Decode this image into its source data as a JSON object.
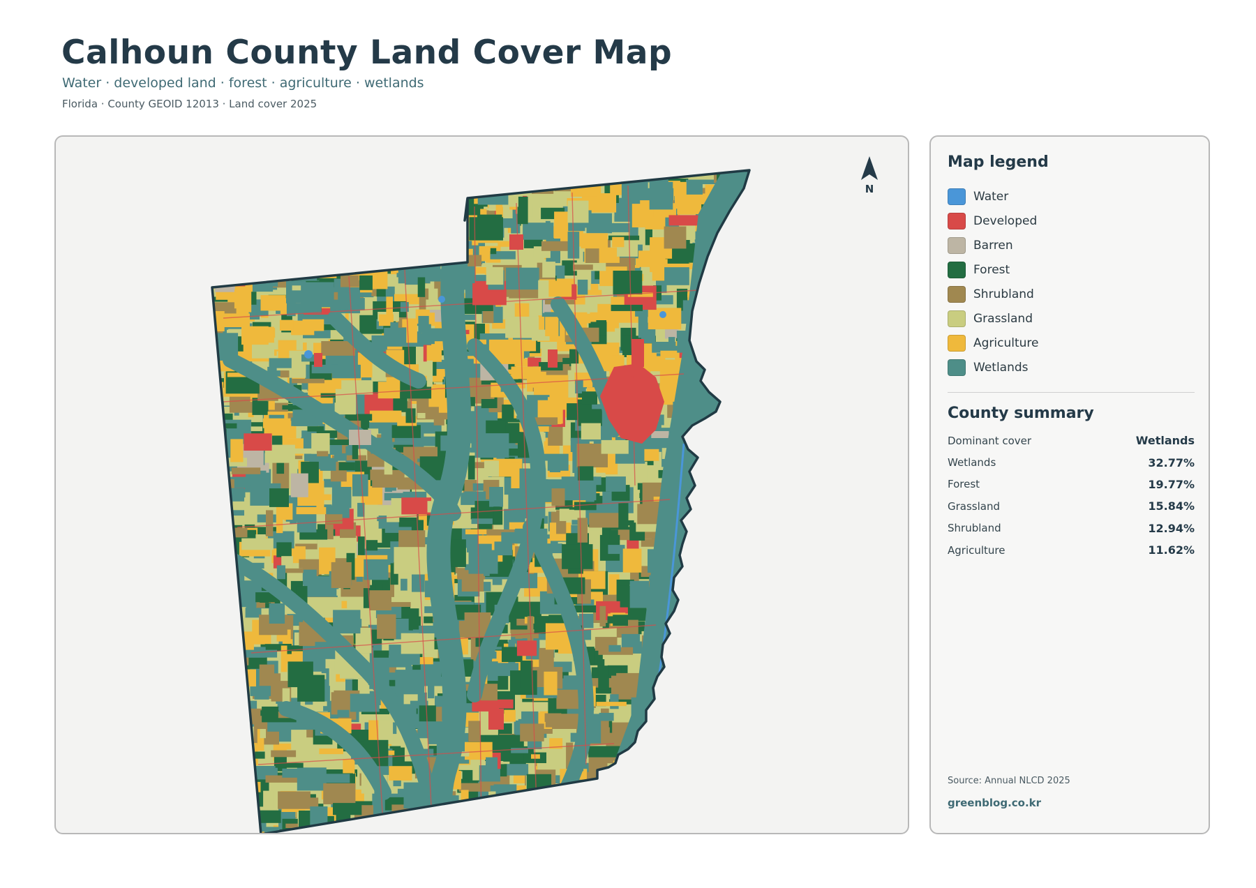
{
  "header": {
    "title": "Calhoun County Land Cover Map",
    "subtitle": "Water · developed land · forest · agriculture · wetlands",
    "meta": "Florida · County GEOID 12013 · Land cover 2025"
  },
  "map": {
    "north_label": "N"
  },
  "legend": {
    "heading": "Map legend",
    "items": [
      {
        "label": "Water",
        "color": "#4a96d8"
      },
      {
        "label": "Developed",
        "color": "#d84a48"
      },
      {
        "label": "Barren",
        "color": "#bdb5a4"
      },
      {
        "label": "Forest",
        "color": "#236d42"
      },
      {
        "label": "Shrubland",
        "color": "#a08850"
      },
      {
        "label": "Grassland",
        "color": "#c9cd80"
      },
      {
        "label": "Agriculture",
        "color": "#efb93c"
      },
      {
        "label": "Wetlands",
        "color": "#4e8e88"
      }
    ]
  },
  "summary": {
    "heading": "County summary",
    "rows": [
      {
        "key": "Dominant cover",
        "value": "Wetlands"
      },
      {
        "key": "Wetlands",
        "value": "32.77%"
      },
      {
        "key": "Forest",
        "value": "19.77%"
      },
      {
        "key": "Grassland",
        "value": "15.84%"
      },
      {
        "key": "Shrubland",
        "value": "12.94%"
      },
      {
        "key": "Agriculture",
        "value": "11.62%"
      }
    ]
  },
  "footer": {
    "source": "Source: Annual NLCD 2025",
    "site": "greenblog.co.kr"
  }
}
